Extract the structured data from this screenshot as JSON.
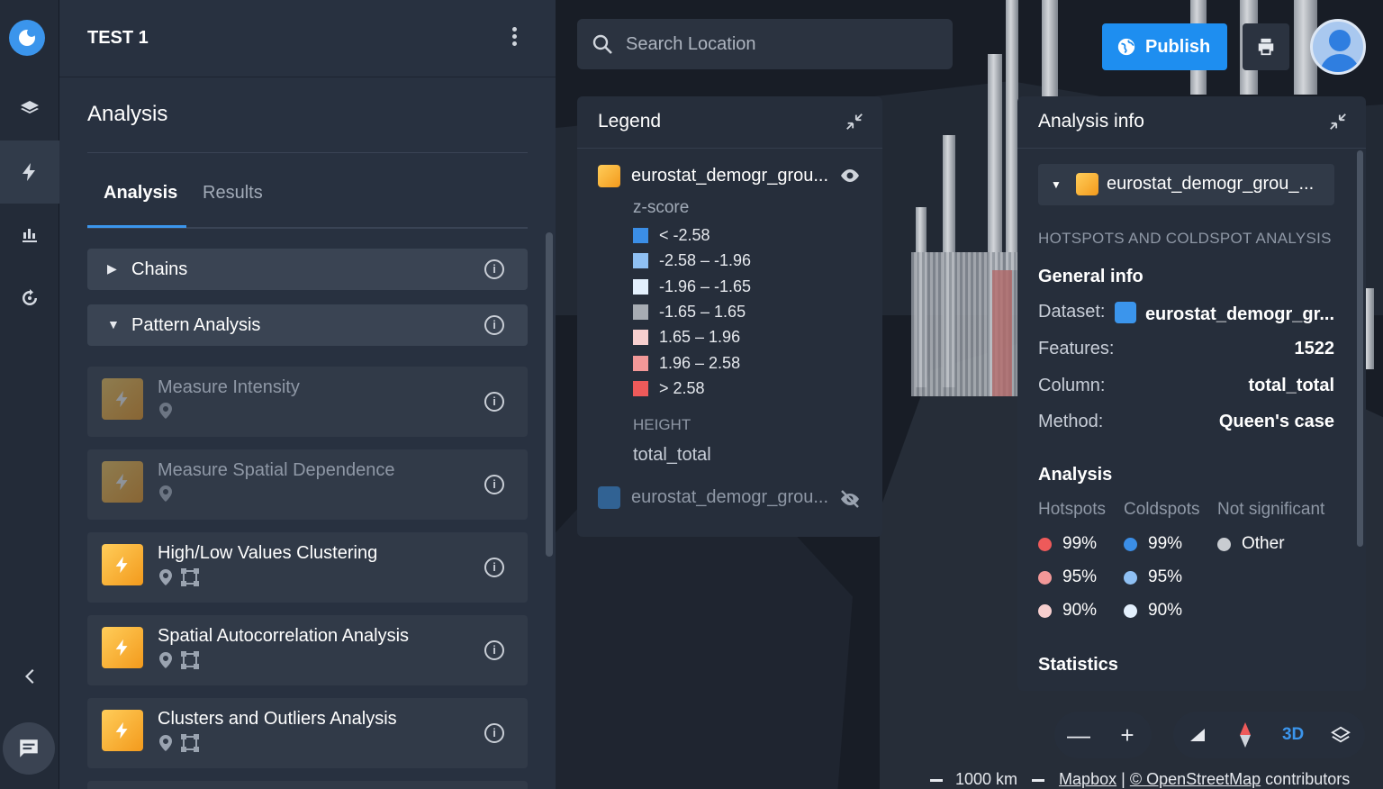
{
  "project": {
    "title": "TEST 1"
  },
  "rail": {
    "items": [
      "layers-icon",
      "analysis-bolt-icon",
      "bar-chart-icon",
      "history-icon"
    ]
  },
  "panel": {
    "section_title": "Analysis",
    "tabs": [
      {
        "label": "Analysis"
      },
      {
        "label": "Results"
      }
    ],
    "groups": [
      {
        "label": "Chains"
      },
      {
        "label": "Pattern Analysis"
      }
    ],
    "cards": [
      {
        "label": "Measure Intensity",
        "enabled": false
      },
      {
        "label": "Measure Spatial Dependence",
        "enabled": false
      },
      {
        "label": "High/Low Values Clustering",
        "enabled": true
      },
      {
        "label": "Spatial Autocorrelation Analysis",
        "enabled": true
      },
      {
        "label": "Clusters and Outliers Analysis",
        "enabled": true
      }
    ]
  },
  "search": {
    "placeholder": "Search Location"
  },
  "toolbar": {
    "publish_label": "Publish"
  },
  "legend": {
    "title": "Legend",
    "layer1": "eurostat_demogr_grou...",
    "zscore_title": "z-score",
    "items": [
      {
        "label": "< -2.58",
        "color": "#3b8ee6"
      },
      {
        "label": "-2.58 – -1.96",
        "color": "#8fc0f3"
      },
      {
        "label": "-1.96 – -1.65",
        "color": "#e3f0fd"
      },
      {
        "label": "-1.65 – 1.65",
        "color": "#a7acb3"
      },
      {
        "label": "1.65 – 1.96",
        "color": "#f7cfcf"
      },
      {
        "label": "1.96 – 2.58",
        "color": "#f29898"
      },
      {
        "label": "> 2.58",
        "color": "#ee5a5a"
      }
    ],
    "height_title": "HEIGHT",
    "height_value": "total_total",
    "layer2": "eurostat_demogr_grou..."
  },
  "analysis_info": {
    "title": "Analysis info",
    "selected_layer": "eurostat_demogr_grou_...",
    "caption": "HOTSPOTS AND COLDSPOT ANALYSIS",
    "general_title": "General info",
    "dataset_label": "Dataset:",
    "dataset_value": "eurostat_demogr_gr...",
    "features_label": "Features:",
    "features_value": "1522",
    "column_label": "Column:",
    "column_value": "total_total",
    "method_label": "Method:",
    "method_value": "Queen's case",
    "analysis_title": "Analysis",
    "col_hot": "Hotspots",
    "col_cold": "Coldspots",
    "col_ns": "Not significant",
    "hot": [
      {
        "label": "99%",
        "color": "#ee5a5a"
      },
      {
        "label": "95%",
        "color": "#f29898"
      },
      {
        "label": "90%",
        "color": "#f7cfcf"
      }
    ],
    "cold": [
      {
        "label": "99%",
        "color": "#3b8ee6"
      },
      {
        "label": "95%",
        "color": "#8fc0f3"
      },
      {
        "label": "90%",
        "color": "#e3f0fd"
      }
    ],
    "other": {
      "label": "Other",
      "color": "#c8ccd1"
    },
    "statistics_title": "Statistics"
  },
  "map_controls": {
    "mode_3d": "3D"
  },
  "attribution": {
    "scale": "1000 km",
    "mapbox": "Mapbox",
    "sep": "|",
    "osm": "© OpenStreetMap",
    "contrib": "contributors"
  }
}
